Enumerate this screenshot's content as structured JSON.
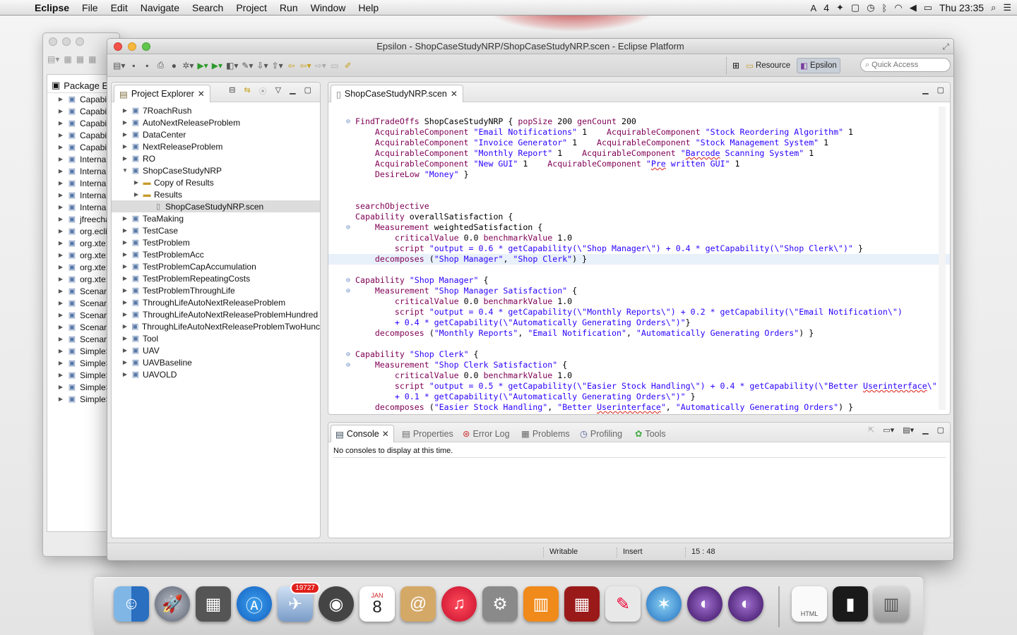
{
  "menubar": {
    "app": "Eclipse",
    "items": [
      "File",
      "Edit",
      "Navigate",
      "Search",
      "Project",
      "Run",
      "Window",
      "Help"
    ],
    "status_badge": "4",
    "clock": "Thu 23:35"
  },
  "back_window": {
    "title": "Package Ex",
    "rows": [
      "Capabil",
      "Capabil",
      "Capabil",
      "Capabil",
      "Capabil",
      "Internal",
      "Internal",
      "Internal",
      "Internal",
      "Internal",
      "jfreecha",
      "org.ecli",
      "org.xte:",
      "org.xte:",
      "org.xte:",
      "org.xte:",
      "Scenaric",
      "Scenaric",
      "Scenaric",
      "Scenaric",
      "Scenaric",
      "SimpleS",
      "SimpleS",
      "SimpleS",
      "SimpleS",
      "SimpleS"
    ]
  },
  "window": {
    "title": "Epsilon - ShopCaseStudyNRP/ShopCaseStudyNRP.scen - Eclipse Platform"
  },
  "perspectives": {
    "resource": "Resource",
    "epsilon": "Epsilon"
  },
  "quick_access": {
    "placeholder": "Quick Access"
  },
  "explorer": {
    "title": "Project Explorer",
    "items": [
      {
        "label": "7RoachRush",
        "indent": 0,
        "expanded": false,
        "kind": "project"
      },
      {
        "label": "AutoNextReleaseProblem",
        "indent": 0,
        "expanded": false,
        "kind": "project"
      },
      {
        "label": "DataCenter",
        "indent": 0,
        "expanded": false,
        "kind": "project"
      },
      {
        "label": "NextReleaseProblem",
        "indent": 0,
        "expanded": false,
        "kind": "project"
      },
      {
        "label": "RO",
        "indent": 0,
        "expanded": false,
        "kind": "project"
      },
      {
        "label": "ShopCaseStudyNRP",
        "indent": 0,
        "expanded": true,
        "kind": "project"
      },
      {
        "label": "Copy of Results",
        "indent": 1,
        "expanded": false,
        "kind": "folder"
      },
      {
        "label": "Results",
        "indent": 1,
        "expanded": false,
        "kind": "folder"
      },
      {
        "label": "ShopCaseStudyNRP.scen",
        "indent": 2,
        "expanded": null,
        "kind": "file",
        "selected": true
      },
      {
        "label": "TeaMaking",
        "indent": 0,
        "expanded": false,
        "kind": "project"
      },
      {
        "label": "TestCase",
        "indent": 0,
        "expanded": false,
        "kind": "project"
      },
      {
        "label": "TestProblem",
        "indent": 0,
        "expanded": false,
        "kind": "project"
      },
      {
        "label": "TestProblemAcc",
        "indent": 0,
        "expanded": false,
        "kind": "project"
      },
      {
        "label": "TestProblemCapAccumulation",
        "indent": 0,
        "expanded": false,
        "kind": "project"
      },
      {
        "label": "TestProblemRepeatingCosts",
        "indent": 0,
        "expanded": false,
        "kind": "project"
      },
      {
        "label": "TestProblemThroughLife",
        "indent": 0,
        "expanded": false,
        "kind": "project"
      },
      {
        "label": "ThroughLifeAutoNextReleaseProblem",
        "indent": 0,
        "expanded": false,
        "kind": "project"
      },
      {
        "label": "ThroughLifeAutoNextReleaseProblemHundred",
        "indent": 0,
        "expanded": false,
        "kind": "project"
      },
      {
        "label": "ThroughLifeAutoNextReleaseProblemTwoHunc",
        "indent": 0,
        "expanded": false,
        "kind": "project"
      },
      {
        "label": "Tool",
        "indent": 0,
        "expanded": false,
        "kind": "project"
      },
      {
        "label": "UAV",
        "indent": 0,
        "expanded": false,
        "kind": "project"
      },
      {
        "label": "UAVBaseline",
        "indent": 0,
        "expanded": false,
        "kind": "project"
      },
      {
        "label": "UAVOLD",
        "indent": 0,
        "expanded": false,
        "kind": "project"
      }
    ]
  },
  "editor": {
    "tab": "ShopCaseStudyNRP.scen",
    "lines": [
      {
        "t": "",
        "f": ""
      },
      {
        "f": "⊖",
        "t": "<span class=\"kw\">FindTradeOffs</span> ShopCaseStudyNRP { <span class=\"kw\">popSize</span> 200 <span class=\"kw\">genCount</span> 200"
      },
      {
        "f": "",
        "t": "    <span class=\"kw\">AcquirableComponent</span> <span class=\"str\">\"Email Notifications\"</span> 1    <span class=\"kw\">AcquirableComponent</span> <span class=\"str\">\"Stock Reordering Algorithm\"</span> 1"
      },
      {
        "f": "",
        "t": "    <span class=\"kw\">AcquirableComponent</span> <span class=\"str\">\"Invoice Generator\"</span> 1    <span class=\"kw\">AcquirableComponent</span> <span class=\"str\">\"Stock Management System\"</span> 1"
      },
      {
        "f": "",
        "t": "    <span class=\"kw\">AcquirableComponent</span> <span class=\"str\">\"Monthly Report\"</span> 1    <span class=\"kw\">AcquirableComponent</span> <span class=\"str\">\"<span class=\"err\">Barcode</span> Scanning System\"</span> 1"
      },
      {
        "f": "",
        "t": "    <span class=\"kw\">AcquirableComponent</span> <span class=\"str\">\"New GUI\"</span> 1    <span class=\"kw\">AcquirableComponent</span> <span class=\"str\">\"<span class=\"err\">Pre</span> written GUI\"</span> 1"
      },
      {
        "f": "",
        "t": "    <span class=\"kw\">DesireLow</span> <span class=\"str\">\"Money\"</span> }"
      },
      {
        "f": "",
        "t": ""
      },
      {
        "f": "",
        "t": ""
      },
      {
        "f": "",
        "t": "<span class=\"kw\">searchObjective</span>"
      },
      {
        "f": "",
        "t": "<span class=\"kw\">Capability</span> overallSatisfaction {"
      },
      {
        "f": "⊖",
        "t": "    <span class=\"kw\">Measurement</span> weightedSatisfaction {"
      },
      {
        "f": "",
        "t": "        <span class=\"kw\">criticalValue</span> 0.0 <span class=\"kw\">benchmarkValue</span> 1.0"
      },
      {
        "f": "",
        "t": "        <span class=\"kw\">script</span> <span class=\"str\">\"output = 0.6 * getCapability(\\\"Shop Manager\\\") + 0.4 * getCapability(\\\"Shop Clerk\\\")\"</span> }"
      },
      {
        "f": "",
        "hl": true,
        "t": "    <span class=\"kw\">decomposes</span> (<span class=\"str\">\"Shop Manager\"</span>, <span class=\"str\">\"Shop Clerk\"</span>) }"
      },
      {
        "f": "",
        "t": ""
      },
      {
        "f": "⊖",
        "t": "<span class=\"kw\">Capability</span> <span class=\"str\">\"Shop Manager\"</span> {"
      },
      {
        "f": "⊖",
        "t": "    <span class=\"kw\">Measurement</span> <span class=\"str\">\"Shop Manager Satisfaction\"</span> {"
      },
      {
        "f": "",
        "t": "        <span class=\"kw\">criticalValue</span> 0.0 <span class=\"kw\">benchmarkValue</span> 1.0"
      },
      {
        "f": "",
        "t": "        <span class=\"kw\">script</span> <span class=\"str\">\"output = 0.4 * getCapability(\\\"Monthly Reports\\\") + 0.2 * getCapability(\\\"Email Notification\\\")</span>"
      },
      {
        "f": "",
        "t": "        <span class=\"str\">+ 0.4 * getCapability(\\\"Automatically Generating Orders\\\")\"</span>}"
      },
      {
        "f": "",
        "t": "    <span class=\"kw\">decomposes</span> (<span class=\"str\">\"Monthly Reports\"</span>, <span class=\"str\">\"Email Notification\"</span>, <span class=\"str\">\"Automatically Generating Orders\"</span>) }"
      },
      {
        "f": "",
        "t": ""
      },
      {
        "f": "⊖",
        "t": "<span class=\"kw\">Capability</span> <span class=\"str\">\"Shop Clerk\"</span> {"
      },
      {
        "f": "⊖",
        "t": "    <span class=\"kw\">Measurement</span> <span class=\"str\">\"Shop Clerk Satisfaction\"</span> {"
      },
      {
        "f": "",
        "t": "        <span class=\"kw\">criticalValue</span> 0.0 <span class=\"kw\">benchmarkValue</span> 1.0"
      },
      {
        "f": "",
        "t": "        <span class=\"kw\">script</span> <span class=\"str\">\"output = 0.5 * getCapability(\\\"Easier Stock Handling\\\") + 0.4 * getCapability(\\\"Better <span class=\"err\">Userinterface</span>\\\"</span>"
      },
      {
        "f": "",
        "t": "        <span class=\"str\">+ 0.1 * getCapability(\\\"Automatically Generating Orders\\\")\"</span> }"
      },
      {
        "f": "",
        "t": "    <span class=\"kw\">decomposes</span> (<span class=\"str\">\"Easier Stock Handling\"</span>, <span class=\"str\">\"Better <span class=\"err\">Userinterface</span>\"</span>, <span class=\"str\">\"Automatically Generating Orders\"</span>) }"
      }
    ]
  },
  "console": {
    "tabs": [
      "Console",
      "Properties",
      "Error Log",
      "Problems",
      "Profiling",
      "Tools"
    ],
    "message": "No consoles to display at this time."
  },
  "status": {
    "writable": "Writable",
    "mode": "Insert",
    "position": "15 : 48"
  },
  "dock": {
    "mail_badge": "19727",
    "calendar_month": "JAN",
    "calendar_day": "8",
    "html_label": "HTML"
  }
}
